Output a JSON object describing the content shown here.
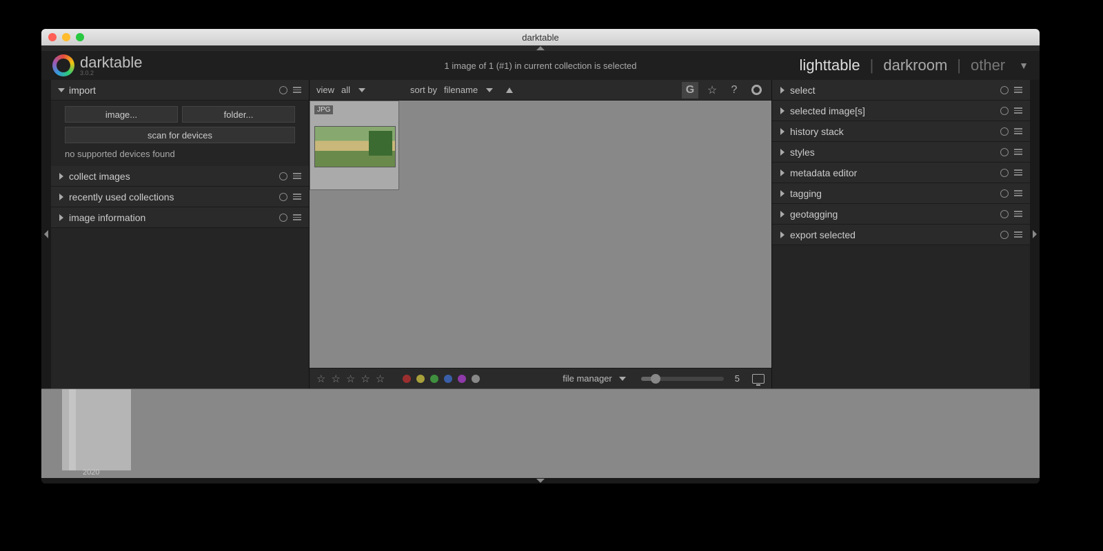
{
  "titlebar": {
    "title": "darktable"
  },
  "logo": {
    "name": "darktable",
    "version": "3.0.2"
  },
  "collection_status": "1 image of 1 (#1) in current collection is selected",
  "view_tabs": {
    "lighttable": "lighttable",
    "darkroom": "darkroom",
    "other": "other"
  },
  "left_panels": {
    "import": {
      "title": "import",
      "image_btn": "image...",
      "folder_btn": "folder...",
      "scan_btn": "scan for devices",
      "no_devices": "no supported devices found"
    },
    "collect": {
      "title": "collect images"
    },
    "recent": {
      "title": "recently used collections"
    },
    "imageinfo": {
      "title": "image information"
    }
  },
  "right_panels": {
    "select": "select",
    "selected_images": "selected image[s]",
    "history_stack": "history stack",
    "styles": "styles",
    "metadata_editor": "metadata editor",
    "tagging": "tagging",
    "geotagging": "geotagging",
    "export_selected": "export selected"
  },
  "filterbar": {
    "view_label": "view",
    "view_value": "all",
    "sort_label": "sort by",
    "sort_value": "filename",
    "group_label": "G"
  },
  "thumbnail": {
    "ext": "JPG"
  },
  "bottombar": {
    "mode": "file manager",
    "zoom_value": "5",
    "colors": [
      "#9b2f2f",
      "#a8a03a",
      "#3f8f3f",
      "#3a5fa8",
      "#8e3aa8",
      "#888888"
    ]
  },
  "timeline": {
    "year": "2020"
  }
}
